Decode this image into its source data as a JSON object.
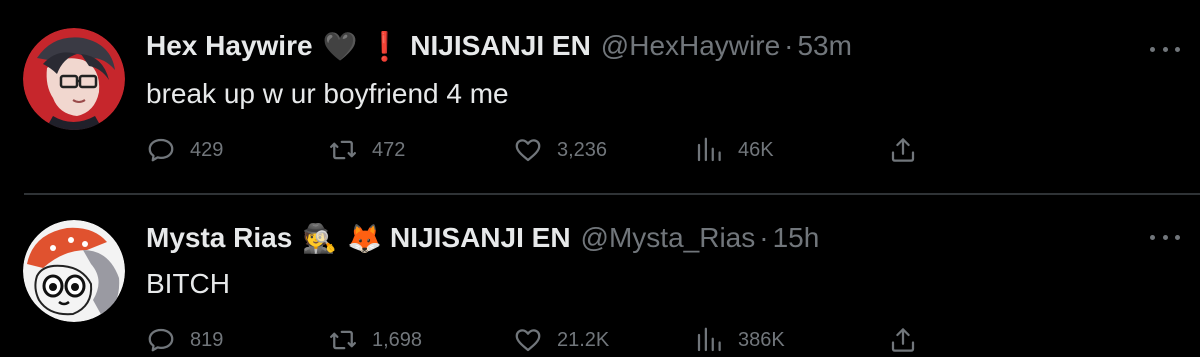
{
  "tweets": [
    {
      "author_name": "Hex Haywire",
      "emoji_1": "🖤",
      "emoji_2": "❗",
      "affiliation": "NIJISANJI EN",
      "handle": "@HexHaywire",
      "separator": "·",
      "time": "53m",
      "text": "break up w ur boyfriend 4 me",
      "replies": "429",
      "retweets": "472",
      "likes": "3,236",
      "views": "46K",
      "avatar": "hex-haywire-avatar"
    },
    {
      "author_name": "Mysta Rias",
      "emoji_1": "🕵️",
      "emoji_2": "🦊",
      "affiliation": "NIJISANJI EN",
      "handle": "@Mysta_Rias",
      "separator": "·",
      "time": "15h",
      "text": "BITCH",
      "replies": "819",
      "retweets": "1,698",
      "likes": "21.2K",
      "views": "386K",
      "avatar": "mysta-rias-avatar"
    }
  ],
  "colors": {
    "background": "#000000",
    "primary_text": "#e7e9ea",
    "secondary_text": "#71767b",
    "divider": "#2f3336"
  },
  "icons": {
    "reply": "speech-bubble-icon",
    "retweet": "retweet-icon",
    "like": "heart-icon",
    "views": "bar-chart-icon",
    "share": "share-upload-icon",
    "more": "more-dots-icon"
  }
}
